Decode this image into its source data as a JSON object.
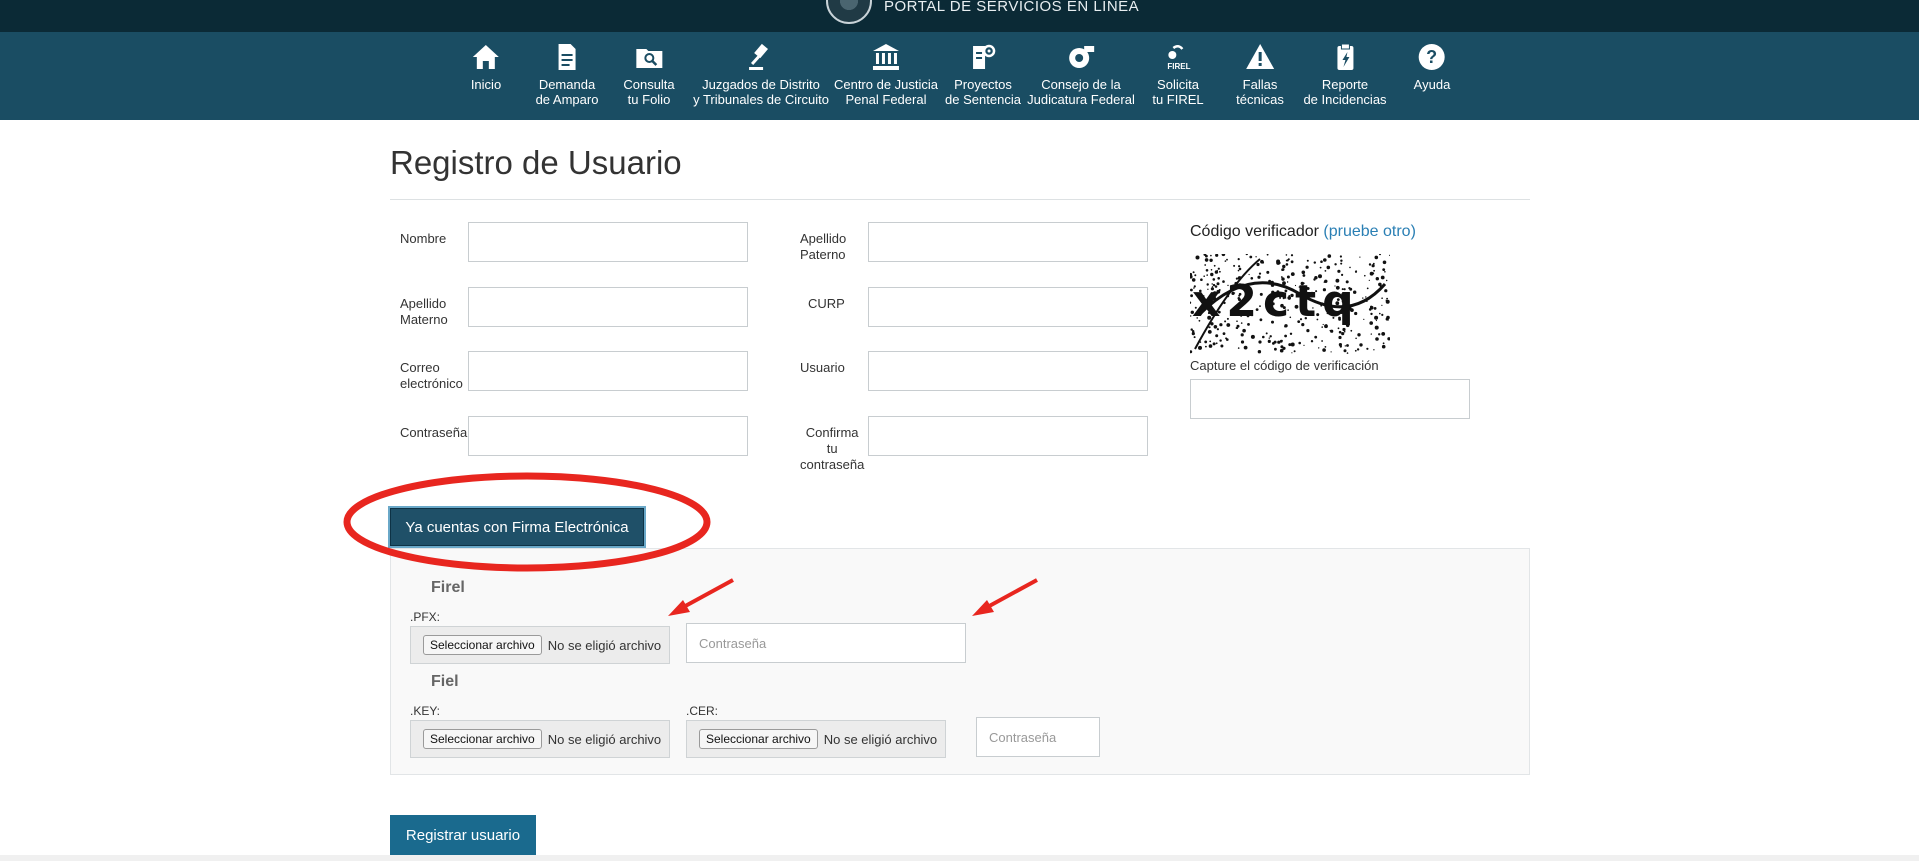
{
  "header": {
    "portal_title": "PORTAL DE SERVICIOS EN LÍNEA"
  },
  "nav": [
    {
      "id": "inicio",
      "icon": "home-icon",
      "lines": [
        "Inicio"
      ]
    },
    {
      "id": "demanda",
      "icon": "document-icon",
      "lines": [
        "Demanda",
        "de Amparo"
      ]
    },
    {
      "id": "consulta",
      "icon": "folder-search-icon",
      "lines": [
        "Consulta",
        "tu Folio"
      ]
    },
    {
      "id": "juzgados",
      "icon": "gavel-icon",
      "lines": [
        "Juzgados de Distrito",
        "y Tribunales de Circuito"
      ]
    },
    {
      "id": "centro",
      "icon": "courthouse-icon",
      "lines": [
        "Centro de Justicia",
        "Penal Federal"
      ]
    },
    {
      "id": "proyectos",
      "icon": "document-stamp-icon",
      "lines": [
        "Proyectos",
        "de Sentencia"
      ]
    },
    {
      "id": "consejo",
      "icon": "council-icon",
      "lines": [
        "Consejo de la",
        "Judicatura Federal"
      ]
    },
    {
      "id": "firel",
      "icon": "firel-icon",
      "lines": [
        "Solicita",
        "tu FIREL"
      ]
    },
    {
      "id": "fallas",
      "icon": "warning-icon",
      "lines": [
        "Fallas",
        "técnicas"
      ]
    },
    {
      "id": "reporte",
      "icon": "clipboard-alert-icon",
      "lines": [
        "Reporte",
        "de Incidencias"
      ]
    },
    {
      "id": "ayuda",
      "icon": "help-icon",
      "lines": [
        "Ayuda"
      ]
    }
  ],
  "page": {
    "title": "Registro de Usuario"
  },
  "form": {
    "nombre": "Nombre",
    "apellido_paterno": [
      "Apellido",
      "Paterno"
    ],
    "apellido_materno": [
      "Apellido",
      "Materno"
    ],
    "curp": "CURP",
    "correo": [
      "Correo",
      "electrónico"
    ],
    "usuario": "Usuario",
    "contrasena": "Contraseña",
    "confirma": [
      "Confirma",
      "tu",
      "contraseña"
    ]
  },
  "captcha": {
    "title": "Código verificador",
    "link": "(pruebe otro)",
    "code": "x2ctq",
    "caption": "Capture el código de verificación"
  },
  "firma": {
    "button": "Ya cuentas con Firma Electrónica",
    "firel": {
      "heading": "Firel",
      "pfx_label": ".PFX:",
      "file_button": "Seleccionar archivo",
      "file_status": "No se eligió archivo",
      "password_placeholder": "Contraseña"
    },
    "fiel": {
      "heading": "Fiel",
      "key_label": ".KEY:",
      "cer_label": ".CER:",
      "file_button": "Seleccionar archivo",
      "file_status": "No se eligió archivo",
      "password_placeholder": "Contraseña"
    }
  },
  "actions": {
    "register": "Registrar usuario"
  },
  "colors": {
    "nav_bg": "#1a4d63",
    "top_bg": "#0b2a36",
    "primary": "#1a6a8e",
    "annotation": "#e8261f"
  }
}
